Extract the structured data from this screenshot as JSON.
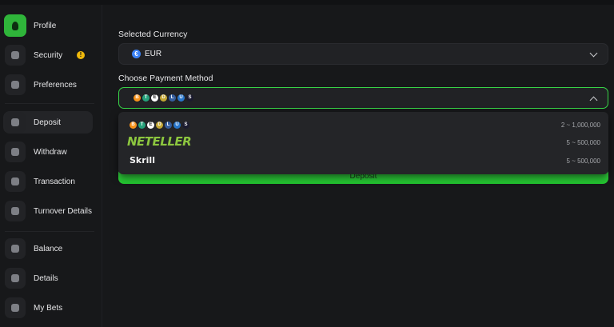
{
  "sidebar": {
    "items": [
      {
        "label": "Profile",
        "icon": "user-icon",
        "active": false,
        "highlight": true
      },
      {
        "label": "Security",
        "icon": "shield-icon",
        "badge": "!"
      },
      {
        "label": "Preferences",
        "icon": "settings-icon"
      },
      {
        "label": "Deposit",
        "icon": "deposit-icon",
        "active": true
      },
      {
        "label": "Withdraw",
        "icon": "withdraw-icon"
      },
      {
        "label": "Transaction",
        "icon": "transaction-icon"
      },
      {
        "label": "Turnover Details",
        "icon": "turnover-icon"
      },
      {
        "label": "Balance",
        "icon": "balance-icon"
      },
      {
        "label": "Details",
        "icon": "details-icon"
      },
      {
        "label": "My Bets",
        "icon": "bets-icon"
      }
    ]
  },
  "form": {
    "currency_label": "Selected Currency",
    "currency_value": "EUR",
    "currency_icon": "€",
    "payment_label": "Choose Payment Method",
    "deposit_label": "Deposit"
  },
  "crypto_coins": [
    {
      "symbol": "B",
      "color": "#f7931a"
    },
    {
      "symbol": "T",
      "color": "#26a17b"
    },
    {
      "symbol": "E",
      "color": "#ffffff",
      "text": "#1a1a1a"
    },
    {
      "symbol": "D",
      "color": "#c2a633"
    },
    {
      "symbol": "L",
      "color": "#345d9d"
    },
    {
      "symbol": "U",
      "color": "#2775ca"
    },
    {
      "symbol": "S",
      "color": "#1b1b2f"
    }
  ],
  "payment_options": [
    {
      "name": "crypto",
      "range": "2 ~ 1,000,000"
    },
    {
      "name": "NETELLER",
      "range": "5 ~ 500,000"
    },
    {
      "name": "Skrill",
      "range": "5 ~ 500,000"
    }
  ],
  "colors": {
    "accent_green": "#38d447",
    "background": "#17181a",
    "warning": "#f0b90b"
  }
}
